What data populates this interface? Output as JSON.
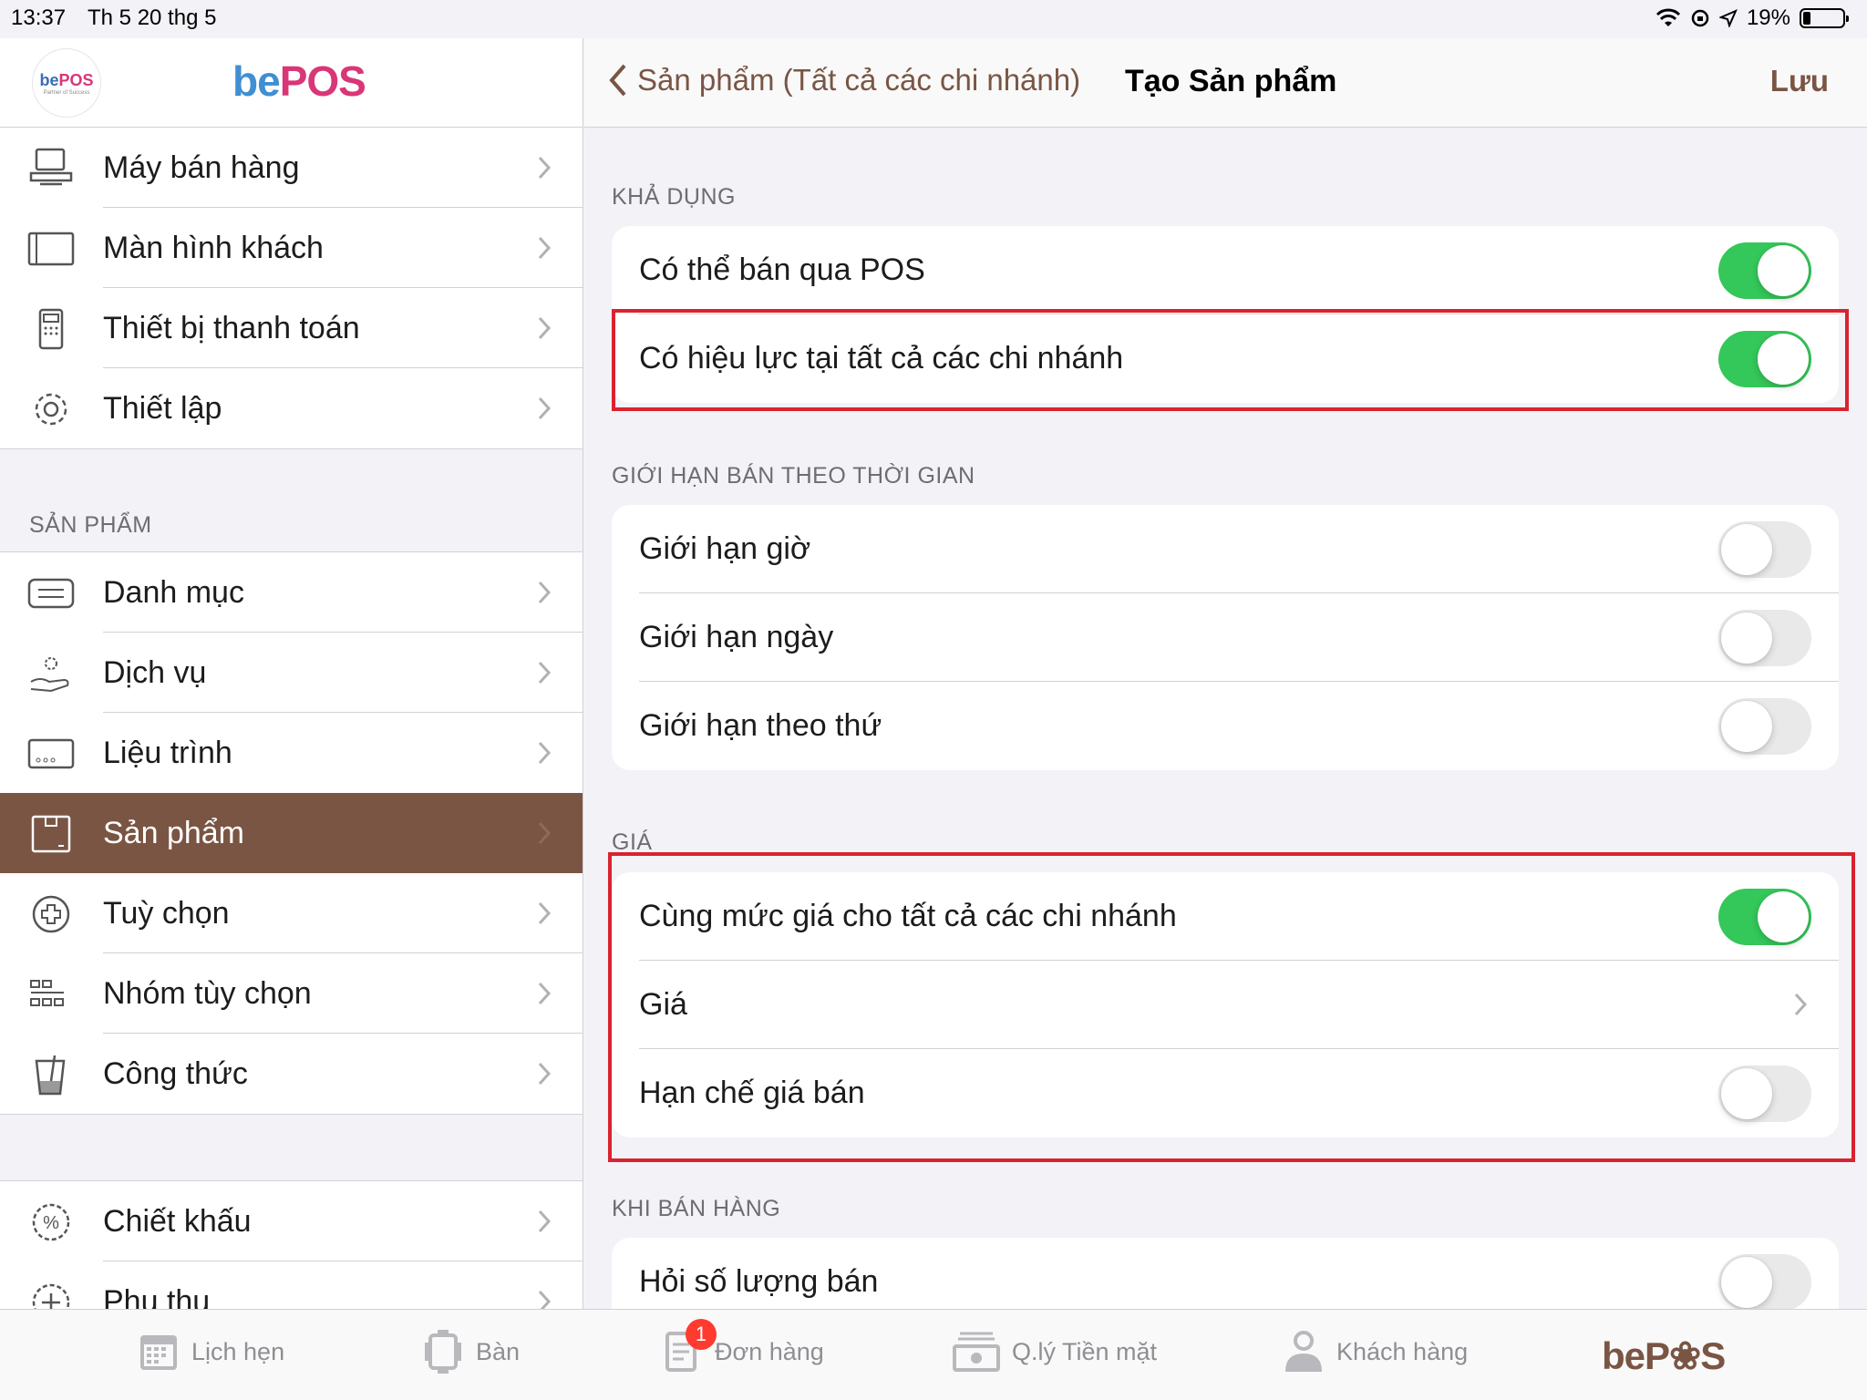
{
  "status_bar": {
    "time": "13:37",
    "date": "Th 5 20 thg 5",
    "battery": "19%"
  },
  "sidebar": {
    "logo_text_be": "be",
    "logo_text_pos": "POS",
    "logo_sub": "Partner of Success",
    "brand_be": "be",
    "brand_pos": "POS",
    "top_items": [
      {
        "label": "Máy bán hàng",
        "icon": "pos-terminal-icon"
      },
      {
        "label": "Màn hình khách",
        "icon": "display-icon"
      },
      {
        "label": "Thiết bị thanh toán",
        "icon": "payment-device-icon"
      },
      {
        "label": "Thiết lập",
        "icon": "gear-icon"
      }
    ],
    "product_section_title": "SẢN PHẨM",
    "product_items": [
      {
        "label": "Danh mục",
        "icon": "category-icon"
      },
      {
        "label": "Dịch vụ",
        "icon": "service-icon"
      },
      {
        "label": "Liệu trình",
        "icon": "card-icon"
      },
      {
        "label": "Sản phẩm",
        "icon": "box-icon",
        "active": true
      },
      {
        "label": "Tuỳ chọn",
        "icon": "plus-circle-icon"
      },
      {
        "label": "Nhóm tùy chọn",
        "icon": "grid-icon"
      },
      {
        "label": "Công thức",
        "icon": "beaker-icon"
      }
    ],
    "bottom_items": [
      {
        "label": "Chiết khấu",
        "icon": "discount-icon"
      },
      {
        "label": "Phụ thu",
        "icon": "surcharge-icon"
      }
    ]
  },
  "navbar": {
    "back_label": "Sản phẩm (Tất cả các chi nhánh)",
    "title": "Tạo Sản phẩm",
    "save_label": "Lưu"
  },
  "sections": {
    "availability": {
      "title": "KHẢ DỤNG",
      "rows": [
        {
          "label": "Có thể bán qua POS",
          "on": true
        },
        {
          "label": "Có hiệu lực tại tất cả các chi nhánh",
          "on": true
        }
      ]
    },
    "time_limit": {
      "title": "GIỚI HẠN BÁN THEO THỜI GIAN",
      "rows": [
        {
          "label": "Giới hạn giờ",
          "on": false
        },
        {
          "label": "Giới hạn ngày",
          "on": false
        },
        {
          "label": "Giới hạn theo thứ",
          "on": false
        }
      ]
    },
    "price": {
      "title": "GIÁ",
      "rows": [
        {
          "label": "Cùng mức giá cho tất cả các chi nhánh",
          "on": true
        },
        {
          "label": "Giá"
        },
        {
          "label": "Hạn chế giá bán",
          "on": false
        }
      ]
    },
    "when_selling": {
      "title": "KHI BÁN HÀNG",
      "rows": [
        {
          "label": "Hỏi số lượng bán",
          "on": false
        }
      ]
    }
  },
  "tabbar": {
    "tabs": [
      {
        "label": "Lịch hẹn",
        "icon": "calendar-icon"
      },
      {
        "label": "Bàn",
        "icon": "table-icon"
      },
      {
        "label": "Đơn hàng",
        "icon": "order-icon",
        "badge": "1"
      },
      {
        "label": "Q.lý Tiền mặt",
        "icon": "cash-icon"
      },
      {
        "label": "Khách hàng",
        "icon": "customer-icon"
      }
    ],
    "brand": "beP❀S"
  },
  "colors": {
    "accent": "#7a5544",
    "toggle_on": "#34c759",
    "highlight": "#d9232f"
  }
}
